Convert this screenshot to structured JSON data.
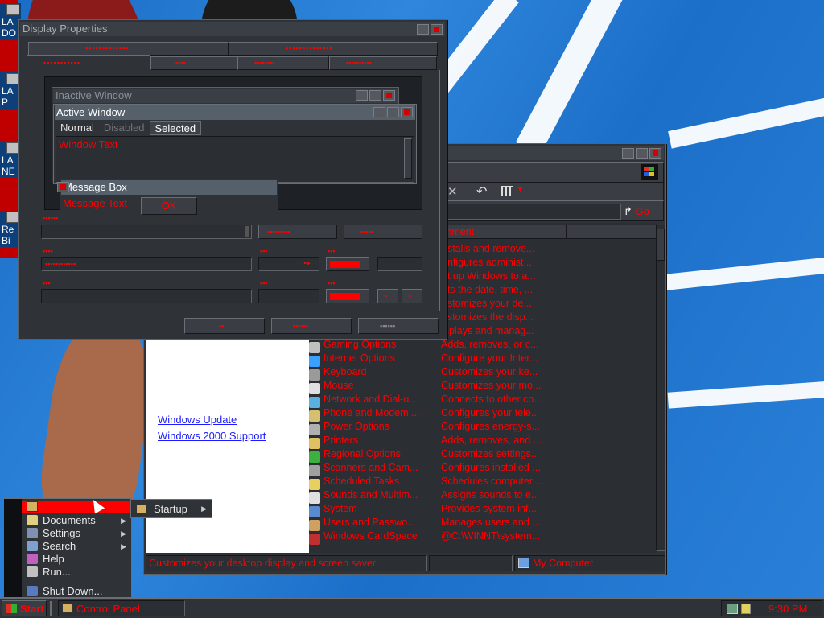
{
  "desktop": {
    "icons": [
      {
        "name": "desktop-icon-1",
        "label": "LA",
        "label2": "DO"
      },
      {
        "name": "desktop-icon-2",
        "label": "LA",
        "label2": "P"
      },
      {
        "name": "desktop-icon-3",
        "label": "LA",
        "label2": "NE"
      },
      {
        "name": "desktop-icon-4",
        "label": "Re",
        "label2": "Bi"
      }
    ]
  },
  "display_props": {
    "title": "Display Properties",
    "preview": {
      "inactive_title": "Inactive Window",
      "active_title": "Active Window",
      "menu": [
        "Normal",
        "Disabled",
        "Selected"
      ],
      "window_text": "Window Text",
      "msgbox_title": "Message Box",
      "msgbox_text": "Message Text",
      "ok": "OK"
    }
  },
  "control_panel": {
    "column_comment": "omment",
    "go": "Go",
    "links": [
      "Windows Update",
      "Windows 2000 Support"
    ],
    "items": [
      {
        "name": "",
        "comment": "nstalls and remove...",
        "color": "#c8c8c8"
      },
      {
        "name": "",
        "comment": "onfigures administ...",
        "color": "#c8c8c8"
      },
      {
        "name": "",
        "comment": "et up Windows to a...",
        "color": "#c8c8c8"
      },
      {
        "name": "",
        "comment": "ets the date, time, ...",
        "color": "#c8c8c8"
      },
      {
        "name": "",
        "comment": "ustomizes your de...",
        "color": "#c8c8c8"
      },
      {
        "name": "",
        "comment": "ustomizes the disp...",
        "color": "#c8c8c8"
      },
      {
        "name": "",
        "comment": "isplays and manag...",
        "color": "#c8c8c8"
      },
      {
        "name": "Gaming Options",
        "comment": "Adds, removes, or c...",
        "color": "#c0c0c0"
      },
      {
        "name": "Internet Options",
        "comment": "Configure your Inter...",
        "color": "#3aa0ff"
      },
      {
        "name": "Keyboard",
        "comment": "Customizes your ke...",
        "color": "#9a9a9a"
      },
      {
        "name": "Mouse",
        "comment": "Customizes your mo...",
        "color": "#e0e0e0"
      },
      {
        "name": "Network and Dial-u...",
        "comment": "Connects to other co...",
        "color": "#5ab0e0"
      },
      {
        "name": "Phone and Modem ...",
        "comment": "Configures your tele...",
        "color": "#d4c070"
      },
      {
        "name": "Power Options",
        "comment": "Configures energy-s...",
        "color": "#b0b0b0"
      },
      {
        "name": "Printers",
        "comment": "Adds, removes, and ...",
        "color": "#e0c060"
      },
      {
        "name": "Regional Options",
        "comment": "Customizes settings...",
        "color": "#3cb040"
      },
      {
        "name": "Scanners and Cam...",
        "comment": "Configures installed ...",
        "color": "#a0a0a0"
      },
      {
        "name": "Scheduled Tasks",
        "comment": "Schedules computer ...",
        "color": "#e8d060"
      },
      {
        "name": "Sounds and Multim...",
        "comment": "Assigns sounds to e...",
        "color": "#e0e0e0"
      },
      {
        "name": "System",
        "comment": "Provides system inf...",
        "color": "#5a8ad0"
      },
      {
        "name": "Users and Passwo...",
        "comment": "Manages users and ...",
        "color": "#d0a060"
      },
      {
        "name": "Windows CardSpace",
        "comment": "@C:\\WINNT\\system...",
        "color": "#c03030"
      }
    ],
    "status_left": "Customizes your desktop display and screen saver.",
    "status_right": "My Computer"
  },
  "start_menu": {
    "items": [
      {
        "label": "Documents",
        "arrow": true
      },
      {
        "label": "Settings",
        "arrow": true
      },
      {
        "label": "Search",
        "arrow": true
      },
      {
        "label": "Help",
        "arrow": false
      },
      {
        "label": "Run...",
        "arrow": false
      },
      {
        "label": "Shut Down...",
        "arrow": false
      }
    ],
    "submenu_item": "Startup"
  },
  "taskbar": {
    "start": "Start",
    "task": "Control Panel",
    "clock": "9:30 PM"
  }
}
